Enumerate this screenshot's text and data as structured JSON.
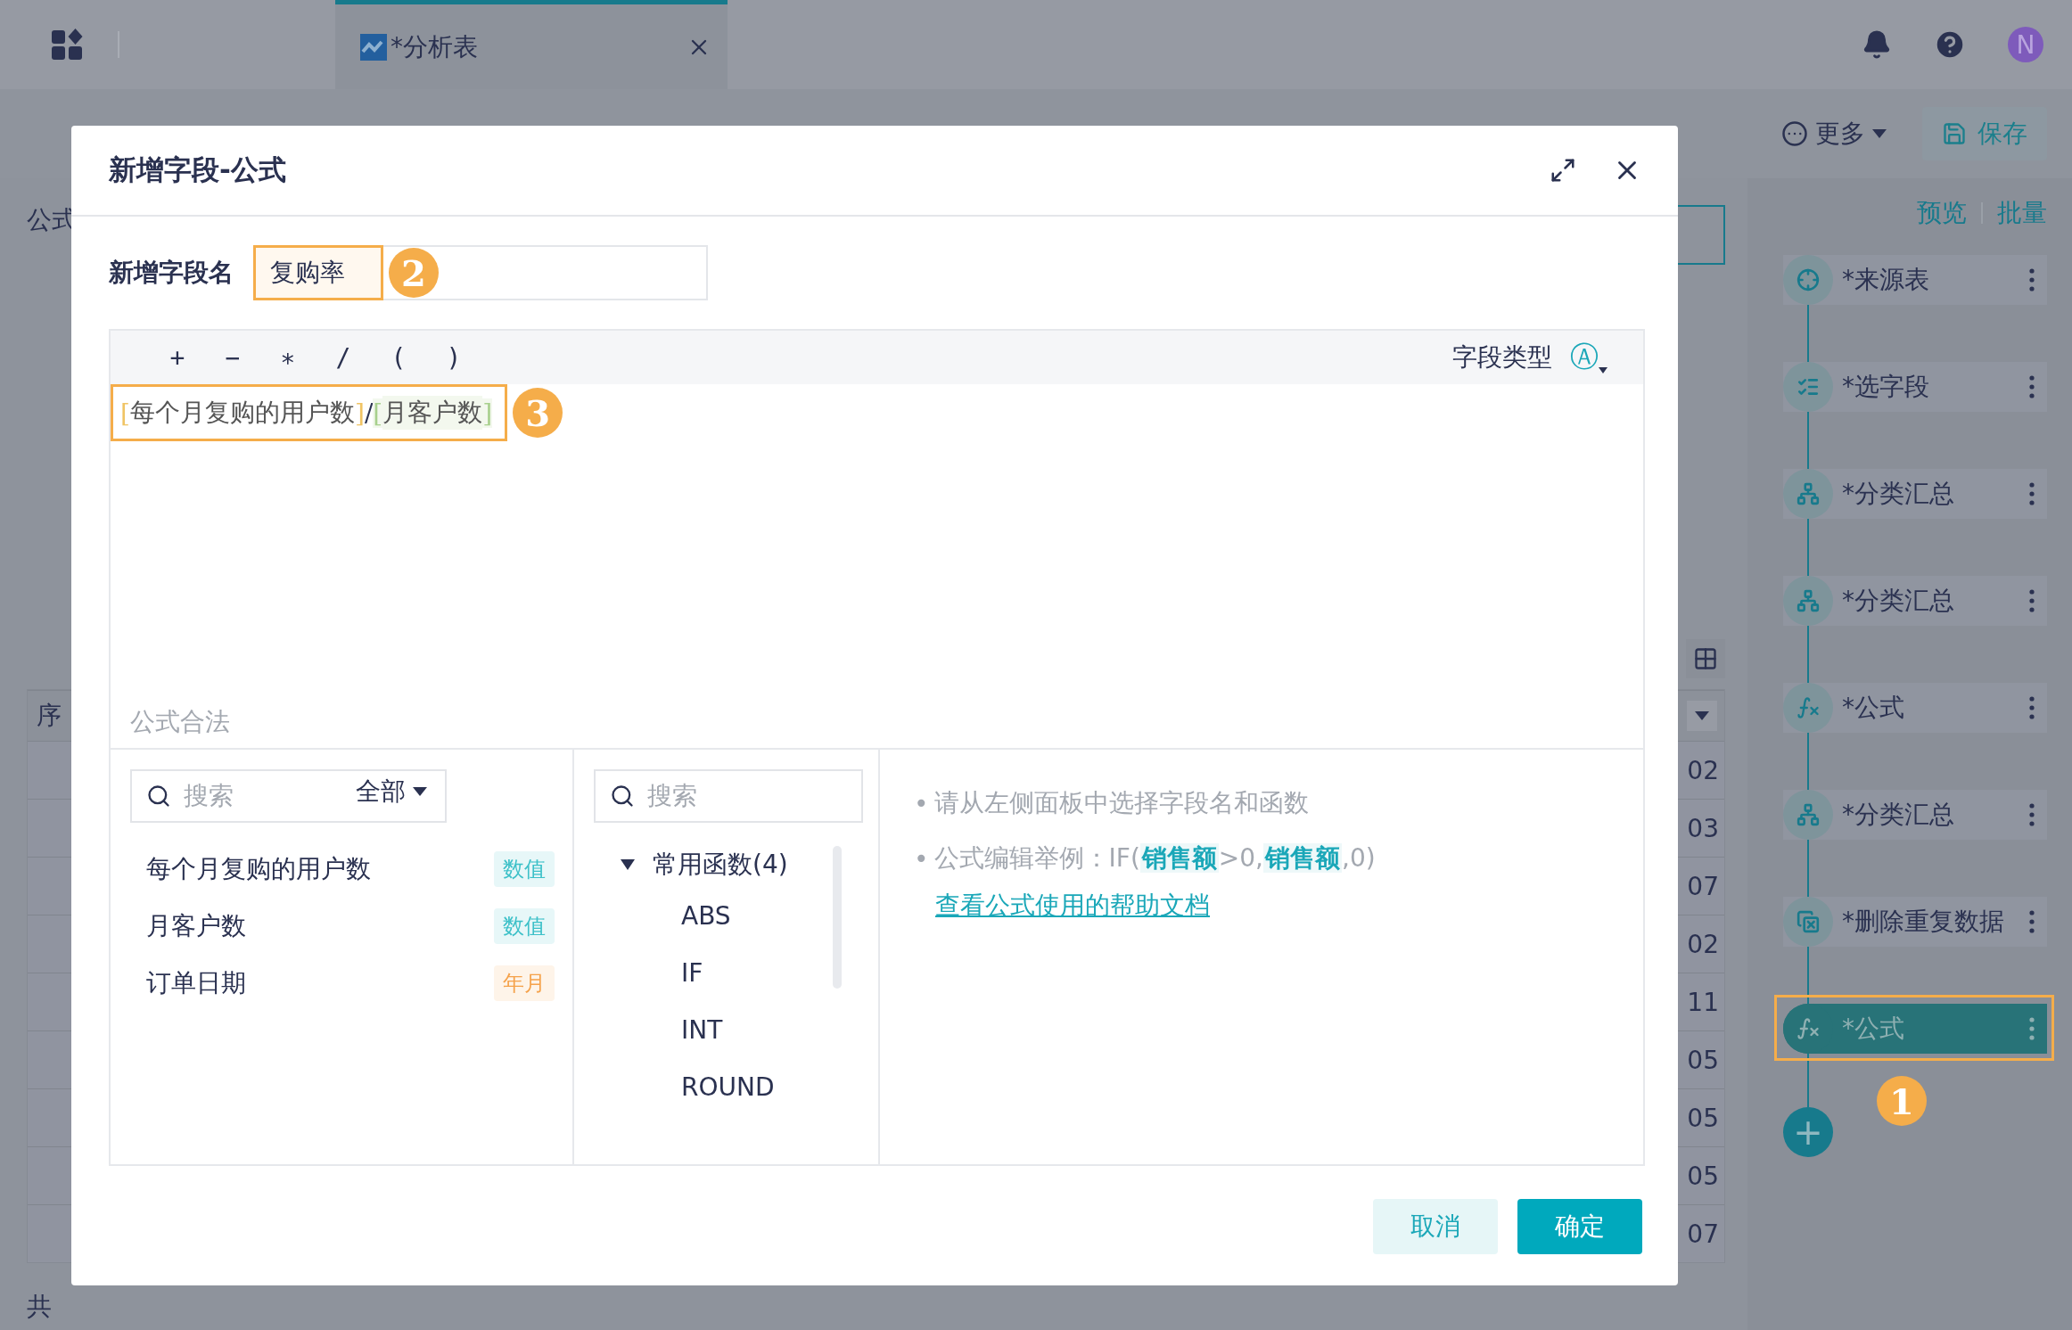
{
  "top_bar": {
    "tab": {
      "title": "*分析表",
      "selected": true
    },
    "avatar": "N"
  },
  "toolbar": {
    "more": "更多",
    "save": "保存"
  },
  "left": {
    "label": "公式",
    "table": {
      "header": "序",
      "rows": [
        "02",
        "03",
        "07",
        "02",
        "11",
        "05",
        "05",
        "05",
        "07"
      ]
    },
    "footer": "共"
  },
  "pipeline": {
    "links": [
      "预览",
      "批量"
    ],
    "annotation": "1",
    "add_button": "+",
    "steps": [
      {
        "kind": "source",
        "label": "*来源表",
        "selected": false
      },
      {
        "kind": "select",
        "label": "*选字段",
        "selected": false
      },
      {
        "kind": "group",
        "label": "*分类汇总",
        "selected": false
      },
      {
        "kind": "group",
        "label": "*分类汇总",
        "selected": false
      },
      {
        "kind": "formula",
        "label": "*公式",
        "selected": false
      },
      {
        "kind": "group",
        "label": "*分类汇总",
        "selected": false
      },
      {
        "kind": "dedupe",
        "label": "*删除重复数据",
        "selected": false
      },
      {
        "kind": "formula",
        "label": "*公式",
        "selected": true
      }
    ]
  },
  "dialog": {
    "title": "新增字段-公式",
    "name_row": {
      "label": "新增字段名",
      "value": "复购率",
      "annotation": "2"
    },
    "editor": {
      "operators": [
        "+",
        "−",
        "∗",
        "/",
        "(",
        ")"
      ],
      "field_type": {
        "label": "字段类型",
        "icon": "Ⓐ"
      },
      "formula": {
        "annotation": "3",
        "tokens": [
          {
            "kind": "bracket",
            "text": "[",
            "color": "#f0c464"
          },
          {
            "kind": "name",
            "text": "每个月复购的用户数"
          },
          {
            "kind": "bracket",
            "text": "]",
            "color": "#f0c464"
          },
          {
            "kind": "operator",
            "text": "/"
          },
          {
            "kind": "bracket",
            "text": "[",
            "color": "#a8d08d"
          },
          {
            "kind": "name",
            "text": "月客户数"
          },
          {
            "kind": "bracket",
            "text": "]",
            "color": "#a8d08d"
          }
        ]
      },
      "status": "公式合法"
    },
    "fields_panel": {
      "search": {
        "placeholder": "搜索"
      },
      "filter": "全部",
      "items": [
        {
          "name": "每个月复购的用户数",
          "type": "数值",
          "color": "#3cc0c8"
        },
        {
          "name": "月客户数",
          "type": "数值",
          "color": "#3cc0c8"
        },
        {
          "name": "订单日期",
          "type": "年月",
          "color": "#f5a24b"
        }
      ]
    },
    "functions_panel": {
      "search": {
        "placeholder": "搜索"
      },
      "groups": [
        {
          "label": "常用函数(4)",
          "expanded": true,
          "children": [
            {
              "label": "ABS"
            },
            {
              "label": "IF"
            },
            {
              "label": "INT"
            },
            {
              "label": "ROUND"
            }
          ]
        }
      ]
    },
    "help": {
      "lines": [
        [
          {
            "kind": "bullet",
            "text": "•"
          },
          {
            "kind": "text",
            "text": "请从左侧面板中选择字段名和函数"
          }
        ],
        [
          {
            "kind": "bullet",
            "text": "•"
          },
          {
            "kind": "text",
            "text": "公式编辑举例：IF("
          },
          {
            "kind": "field",
            "text": "销售额"
          },
          {
            "kind": "text",
            "text": ">0,"
          },
          {
            "kind": "field",
            "text": "销售额"
          },
          {
            "kind": "text",
            "text": ",0)"
          }
        ]
      ],
      "link": "查看公式使用的帮助文档"
    },
    "buttons": [
      {
        "kind": "secondary",
        "label": "取消"
      },
      {
        "kind": "primary",
        "label": "确定"
      }
    ]
  }
}
